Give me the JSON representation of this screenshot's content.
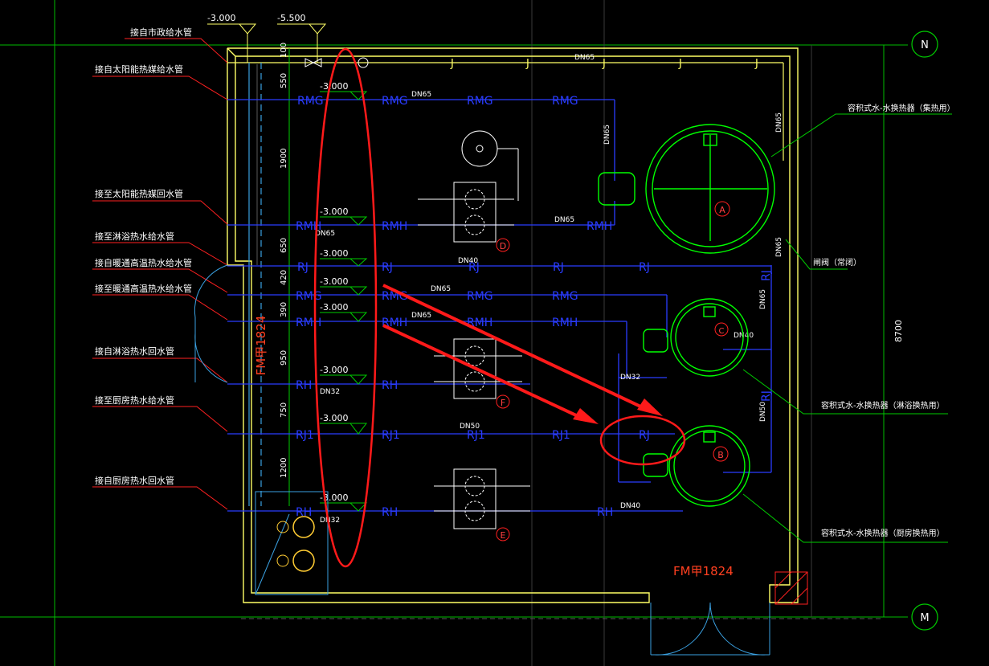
{
  "grid": {
    "top": "N",
    "bottom": "M"
  },
  "overall_dim": "8700",
  "pipe_labels": {
    "municipal_supply": "接自市政给水管",
    "solar_supply": "接自太阳能热媒给水管",
    "solar_return": "接至太阳能热媒回水管",
    "bath_supply": "接至淋浴热水给水管",
    "hvac_supply": "接自暖通高温热水给水管",
    "hvac_return": "接至暖通高温热水给水管",
    "bath_return": "接自淋浴热水回水管",
    "kitchen_supply": "接至厨房热水给水管",
    "kitchen_return": "接自厨房热水回水管"
  },
  "elevations": {
    "top1": "-3.000",
    "top2": "-5.500",
    "e1": "-3.000",
    "e2": "-3.000",
    "e3": "-3.000",
    "e4": "-3.000",
    "e5": "-3.000",
    "e6": "-3.000",
    "e7": "-3.000",
    "e8": "-3.000"
  },
  "dims": [
    "100",
    "550",
    "1900",
    "650",
    "420",
    "390",
    "950",
    "750",
    "1200"
  ],
  "codes": {
    "J": "J",
    "RMG": "RMG",
    "RMH": "RMH",
    "RJ": "RJ",
    "RH": "RH",
    "RJ1": "RJ1"
  },
  "sizes": {
    "dn65": "DN65",
    "dn40": "DN40",
    "dn32": "DN32",
    "dn50": "DN50"
  },
  "heaters": {
    "a_label": "A",
    "b_label": "B",
    "c_label": "C",
    "a_desc": "容积式水-水换热器（集热用）",
    "c_desc": "容积式水-水换热器（淋浴换热用）",
    "b_desc": "容积式水-水换热器（厨房换热用）"
  },
  "pumps": {
    "d": "D",
    "f": "F",
    "e": "E"
  },
  "valve_note": "闸阀（常闭）",
  "door": "FM甲1824",
  "colors": {
    "bg": "#000000",
    "wall": "#ffff66",
    "supply": "#2a3cff",
    "heater": "#00ff00",
    "axis": "#00cc00",
    "text": "#ffffff",
    "mark": "#ff2020",
    "door": "#3aa0e0"
  }
}
